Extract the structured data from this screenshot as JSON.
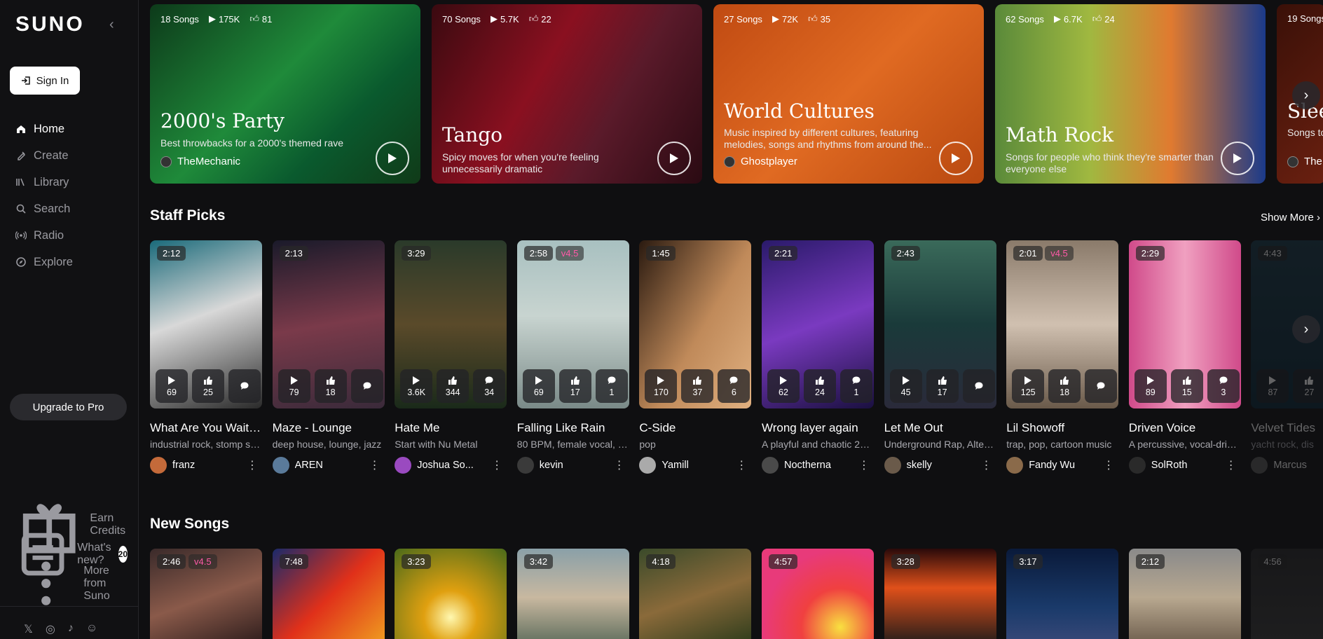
{
  "brand": {
    "logo": "SUNO"
  },
  "sidebar": {
    "sign_in": "Sign In",
    "nav": [
      {
        "label": "Home",
        "icon": "home-icon",
        "active": true
      },
      {
        "label": "Create",
        "icon": "create-icon"
      },
      {
        "label": "Library",
        "icon": "library-icon"
      },
      {
        "label": "Search",
        "icon": "search-icon"
      },
      {
        "label": "Radio",
        "icon": "radio-icon"
      },
      {
        "label": "Explore",
        "icon": "explore-icon"
      }
    ],
    "upgrade": "Upgrade to Pro",
    "bottom": [
      {
        "label": "Earn Credits",
        "icon": "gift-icon"
      },
      {
        "label": "What's new?",
        "icon": "news-icon",
        "badge": "20"
      },
      {
        "label": "More from Suno",
        "icon": "more-vertical-icon"
      }
    ],
    "socials": [
      "x-icon",
      "instagram-icon",
      "tiktok-icon",
      "discord-icon"
    ]
  },
  "playlists": [
    {
      "songs": "18 Songs",
      "plays": "175K",
      "likes": "81",
      "title": "2000's Party",
      "desc": "Best throwbacks for a 2000's themed rave",
      "author": "TheMechanic",
      "bg": "linear-gradient(135deg,#0d3a1a 0%,#1f8a3a 45%,#0a5a2e 70%,#103a18 100%)"
    },
    {
      "songs": "70 Songs",
      "plays": "5.7K",
      "likes": "22",
      "title": "Tango",
      "desc": "Spicy moves for when you're feeling unnecessarily dramatic",
      "author": "",
      "bg": "linear-gradient(120deg,#3a0a10 0%,#8a1020 40%,#5a1a2a 65%,#2a0a12 100%)"
    },
    {
      "songs": "27 Songs",
      "plays": "72K",
      "likes": "35",
      "title": "World Cultures",
      "desc": "Music inspired by different cultures, featuring melodies, songs and rhythms from around the...",
      "author": "Ghostplayer",
      "bg": "linear-gradient(135deg,#c04a12 0%,#e06a22 50%,#b84810 100%)"
    },
    {
      "songs": "62 Songs",
      "plays": "6.7K",
      "likes": "24",
      "title": "Math Rock",
      "desc": "Songs for people who think they're smarter than everyone else",
      "author": "",
      "bg": "linear-gradient(90deg,#5a8a3a 0%,#a0b840 35%,#e07a30 65%,#1a3a8a 100%)"
    },
    {
      "songs": "19 Songs",
      "plays": "",
      "likes": "",
      "title": "Sleep",
      "desc": "Songs to getting r",
      "author": "The",
      "bg": "linear-gradient(135deg,#3a1008 0%,#6a2010 100%)"
    }
  ],
  "staff_picks": {
    "title": "Staff Picks",
    "show_more": "Show More",
    "songs": [
      {
        "dur": "2:12",
        "ver": "",
        "plays": "69",
        "likes": "25",
        "comments": "",
        "title": "What Are You Waiting...",
        "desc": "industrial rock, stomp sto...",
        "author": "franz",
        "bg": "linear-gradient(160deg,#1a6a7a 0%,#d8d8d8 45%,#2a2a2a 100%)",
        "av": "#c46a3a"
      },
      {
        "dur": "2:13",
        "ver": "",
        "plays": "79",
        "likes": "18",
        "comments": "",
        "title": "Maze - Lounge",
        "desc": "deep house, lounge, jazz",
        "author": "AREN",
        "bg": "linear-gradient(170deg,#1a1a2a 0%,#7a3a4a 50%,#3a2a3a 100%)",
        "av": "#5a7a9a"
      },
      {
        "dur": "3:29",
        "ver": "",
        "plays": "3.6K",
        "likes": "344",
        "comments": "34",
        "title": "Hate Me",
        "desc": "Start with Nu Metal",
        "author": "Joshua So...",
        "bg": "linear-gradient(180deg,#2a3a2a 0%,#5a4a2a 50%,#1a2a1a 100%)",
        "av": "#9a4ac0"
      },
      {
        "dur": "2:58",
        "ver": "v4.5",
        "plays": "69",
        "likes": "17",
        "comments": "1",
        "title": "Falling Like Rain",
        "desc": "80 BPM, female vocal, e...",
        "author": "kevin",
        "bg": "linear-gradient(180deg,#a8c0c0 0%,#c8d4d0 45%,#7a8a88 100%)",
        "av": "#3a3a3a"
      },
      {
        "dur": "1:45",
        "ver": "",
        "plays": "170",
        "likes": "37",
        "comments": "6",
        "title": "C-Side",
        "desc": "pop",
        "author": "Yamill",
        "bg": "linear-gradient(120deg,#2a1a10 0%,#c08a5a 55%,#e0b080 100%)",
        "av": "#aaaaaa"
      },
      {
        "dur": "2:21",
        "ver": "",
        "plays": "62",
        "likes": "24",
        "comments": "1",
        "title": "Wrong layer again",
        "desc": "A playful and chaotic 200...",
        "author": "Nocthernа",
        "bg": "linear-gradient(160deg,#2a1a6a 0%,#7a3ac0 50%,#1a1040 100%)",
        "av": "#4a4a4a"
      },
      {
        "dur": "2:43",
        "ver": "",
        "plays": "45",
        "likes": "17",
        "comments": "",
        "title": "Let Me Out",
        "desc": "Underground Rap, Altern...",
        "author": "skelly",
        "bg": "linear-gradient(180deg,#3a6a5a 0%,#1a3a3a 50%,#2a2a3a 100%)",
        "av": "#6a5a4a"
      },
      {
        "dur": "2:01",
        "ver": "v4.5",
        "plays": "125",
        "likes": "18",
        "comments": "",
        "title": "Lil Showoff",
        "desc": "trap, pop, cartoon music",
        "author": "Fandy Wu",
        "bg": "linear-gradient(180deg,#8a7a6a 0%,#d0c0b0 50%,#6a5a4a 100%)",
        "av": "#8a6a4a"
      },
      {
        "dur": "2:29",
        "ver": "",
        "plays": "89",
        "likes": "15",
        "comments": "3",
        "title": "Driven Voice",
        "desc": "A percussive, vocal-drive...",
        "author": "SolRoth",
        "bg": "linear-gradient(90deg,#d04a8a 0%,#f0a0c0 50%,#d04a8a 100%)",
        "av": "#2a2a2a"
      },
      {
        "dur": "4:43",
        "ver": "",
        "plays": "87",
        "likes": "27",
        "comments": "",
        "title": "Velvet Tides",
        "desc": "yacht rock, dis",
        "author": "Marcus",
        "bg": "linear-gradient(180deg,#1a3a4a 0%,#0a2a3a 100%)",
        "av": "#5a5a5a"
      }
    ]
  },
  "new_songs": {
    "title": "New Songs",
    "songs": [
      {
        "dur": "2:46",
        "ver": "v4.5",
        "bg": "linear-gradient(160deg,#3a2a2a 0%,#8a5a4a 50%,#2a1a1a 100%)"
      },
      {
        "dur": "7:48",
        "ver": "",
        "bg": "linear-gradient(135deg,#1a2a6a 0%,#e0301a 50%,#f0a020 100%)"
      },
      {
        "dur": "3:23",
        "ver": "",
        "bg": "radial-gradient(circle at 50% 70%,#fff8b0 0%,#e0a010 30%,#4a6a1a 100%)"
      },
      {
        "dur": "3:42",
        "ver": "",
        "bg": "linear-gradient(180deg,#8aa0a8 0%,#c8b8a0 50%,#5a6a5a 100%)"
      },
      {
        "dur": "4:18",
        "ver": "",
        "bg": "linear-gradient(160deg,#3a4a2a 0%,#8a6a3a 50%,#2a3a1a 100%)"
      },
      {
        "dur": "4:57",
        "ver": "",
        "bg": "radial-gradient(circle at 70% 80%,#f8e040 0%,#f04040 35%,#e83a7a 70%)"
      },
      {
        "dur": "3:28",
        "ver": "",
        "bg": "linear-gradient(180deg,#2a0a0a 0%,#e0501a 40%,#1a1a1a 100%)"
      },
      {
        "dur": "3:17",
        "ver": "",
        "bg": "linear-gradient(180deg,#0a1a3a 0%,#1a3a6a 60%,#3a4a7a 100%)"
      },
      {
        "dur": "2:12",
        "ver": "",
        "bg": "linear-gradient(180deg,#8a8a8a 0%,#b8a890 50%,#6a5a4a 100%)"
      },
      {
        "dur": "4:56",
        "ver": "",
        "bg": "linear-gradient(180deg,#2a2a2a 0%,#3a3a3a 100%)"
      }
    ]
  }
}
